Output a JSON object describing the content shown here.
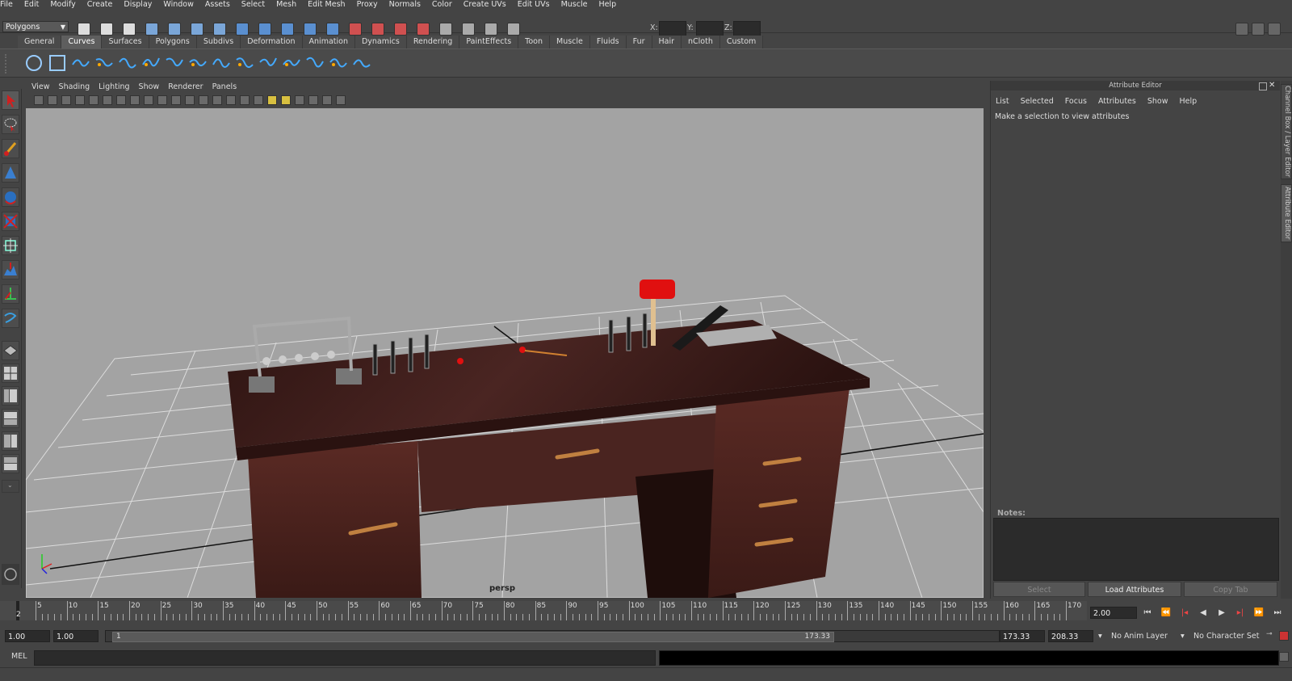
{
  "menubar": [
    "File",
    "Edit",
    "Modify",
    "Create",
    "Display",
    "Window",
    "Assets",
    "Select",
    "Mesh",
    "Edit Mesh",
    "Proxy",
    "Normals",
    "Color",
    "Create UVs",
    "Edit UVs",
    "Muscle",
    "Help"
  ],
  "statusline": {
    "mode": "Polygons",
    "coords": {
      "x_label": "X:",
      "y_label": "Y:",
      "z_label": "Z:",
      "x": "",
      "y": "",
      "z": ""
    }
  },
  "shelf": {
    "tabs": [
      "General",
      "Curves",
      "Surfaces",
      "Polygons",
      "Subdivs",
      "Deformation",
      "Animation",
      "Dynamics",
      "Rendering",
      "PaintEffects",
      "Toon",
      "Muscle",
      "Fluids",
      "Fur",
      "Hair",
      "nCloth",
      "Custom"
    ],
    "active_tab": "Curves",
    "icons": [
      "circle-curve-icon",
      "square-curve-icon",
      "cv-curve-icon",
      "ep-curve-icon",
      "pencil-curve-icon",
      "arc-three-point-icon",
      "arc-two-point-icon",
      "attach-curves-icon",
      "detach-curves-icon",
      "align-curves-icon",
      "open-close-curves-icon",
      "insert-knot-icon",
      "extend-curve-icon",
      "offset-curve-icon",
      "rebuild-curve-icon"
    ]
  },
  "panel": {
    "menus": [
      "View",
      "Shading",
      "Lighting",
      "Show",
      "Renderer",
      "Panels"
    ],
    "camera": "persp"
  },
  "attribute_editor": {
    "title": "Attribute Editor",
    "menus": [
      "List",
      "Selected",
      "Focus",
      "Attributes",
      "Show",
      "Help"
    ],
    "message": "Make a selection to view attributes",
    "notes_label": "Notes:",
    "buttons": {
      "select": "Select",
      "load": "Load Attributes",
      "copy": "Copy Tab"
    }
  },
  "side_tabs": {
    "channel_box": "Channel Box / Layer Editor",
    "attribute_editor": "Attribute Editor"
  },
  "timeslider": {
    "ticks": [
      "5",
      "10",
      "15",
      "20",
      "25",
      "30",
      "35",
      "40",
      "45",
      "50",
      "55",
      "60",
      "65",
      "70",
      "75",
      "80",
      "85",
      "90",
      "95",
      "100",
      "105",
      "110",
      "115",
      "120",
      "125",
      "130",
      "135",
      "140",
      "145",
      "150",
      "155",
      "160",
      "165",
      "170"
    ],
    "current_marker": "2",
    "current_time": "2.00"
  },
  "range": {
    "start_time": "1.00",
    "playback_start": "1.00",
    "slider_start": "1",
    "slider_end": "173.33",
    "playback_end": "173.33",
    "end_time": "208.33",
    "anim_layer": "No Anim Layer",
    "char_set": "No Character Set"
  },
  "command_line": {
    "label": "MEL",
    "value": ""
  },
  "colors": {
    "bg": "#444444",
    "viewport": "#a3a3a3",
    "desk_wood": "#3a1f1c",
    "mallet_head": "#e01010"
  }
}
